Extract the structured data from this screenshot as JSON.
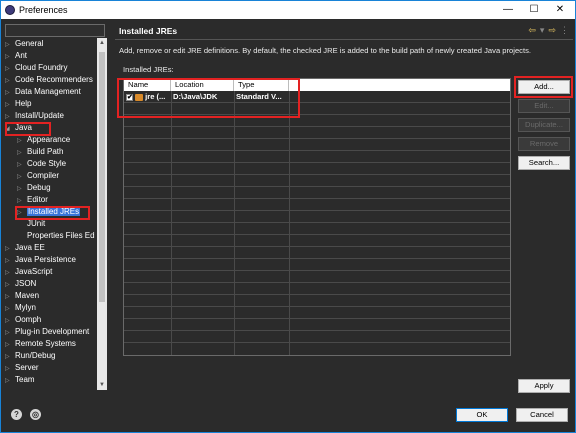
{
  "window": {
    "title": "Preferences",
    "controls": {
      "minimize": "—",
      "maximize": "☐",
      "close": "✕"
    }
  },
  "tree": {
    "items": [
      {
        "label": "General",
        "indent": 0,
        "expandable": true
      },
      {
        "label": "Ant",
        "indent": 0,
        "expandable": true
      },
      {
        "label": "Cloud Foundry",
        "indent": 0,
        "expandable": true
      },
      {
        "label": "Code Recommenders",
        "indent": 0,
        "expandable": true
      },
      {
        "label": "Data Management",
        "indent": 0,
        "expandable": true
      },
      {
        "label": "Help",
        "indent": 0,
        "expandable": true
      },
      {
        "label": "Install/Update",
        "indent": 0,
        "expandable": true
      },
      {
        "label": "Java",
        "indent": 0,
        "expandable": true,
        "expanded": true
      },
      {
        "label": "Appearance",
        "indent": 1,
        "expandable": true
      },
      {
        "label": "Build Path",
        "indent": 1,
        "expandable": true
      },
      {
        "label": "Code Style",
        "indent": 1,
        "expandable": true
      },
      {
        "label": "Compiler",
        "indent": 1,
        "expandable": true
      },
      {
        "label": "Debug",
        "indent": 1,
        "expandable": true
      },
      {
        "label": "Editor",
        "indent": 1,
        "expandable": true
      },
      {
        "label": "Installed JREs",
        "indent": 1,
        "expandable": true,
        "selected": true
      },
      {
        "label": "JUnit",
        "indent": 1,
        "expandable": false
      },
      {
        "label": "Properties Files Ed",
        "indent": 1,
        "expandable": false
      },
      {
        "label": "Java EE",
        "indent": 0,
        "expandable": true
      },
      {
        "label": "Java Persistence",
        "indent": 0,
        "expandable": true
      },
      {
        "label": "JavaScript",
        "indent": 0,
        "expandable": true
      },
      {
        "label": "JSON",
        "indent": 0,
        "expandable": true
      },
      {
        "label": "Maven",
        "indent": 0,
        "expandable": true
      },
      {
        "label": "Mylyn",
        "indent": 0,
        "expandable": true
      },
      {
        "label": "Oomph",
        "indent": 0,
        "expandable": true
      },
      {
        "label": "Plug-in Development",
        "indent": 0,
        "expandable": true
      },
      {
        "label": "Remote Systems",
        "indent": 0,
        "expandable": true
      },
      {
        "label": "Run/Debug",
        "indent": 0,
        "expandable": true
      },
      {
        "label": "Server",
        "indent": 0,
        "expandable": true
      },
      {
        "label": "Team",
        "indent": 0,
        "expandable": true
      }
    ]
  },
  "page": {
    "title": "Installed JREs",
    "description": "Add, remove or edit JRE definitions. By default, the checked JRE is added to the build path of newly created Java projects.",
    "table_label": "Installed JREs:",
    "columns": [
      "Name",
      "Location",
      "Type"
    ],
    "rows": [
      {
        "checked": true,
        "name": "jre (...",
        "location": "D:\\Java\\JDK",
        "type": "Standard V..."
      }
    ],
    "buttons": {
      "add": "Add...",
      "edit": "Edit...",
      "duplicate": "Duplicate...",
      "remove": "Remove",
      "search": "Search...",
      "apply": "Apply"
    }
  },
  "footer": {
    "ok": "OK",
    "cancel": "Cancel",
    "help_icon": "?",
    "import_icon": "◎"
  },
  "colors": {
    "accent": "#3874d8",
    "highlight": "#e32222",
    "background": "#2b2b2b"
  }
}
